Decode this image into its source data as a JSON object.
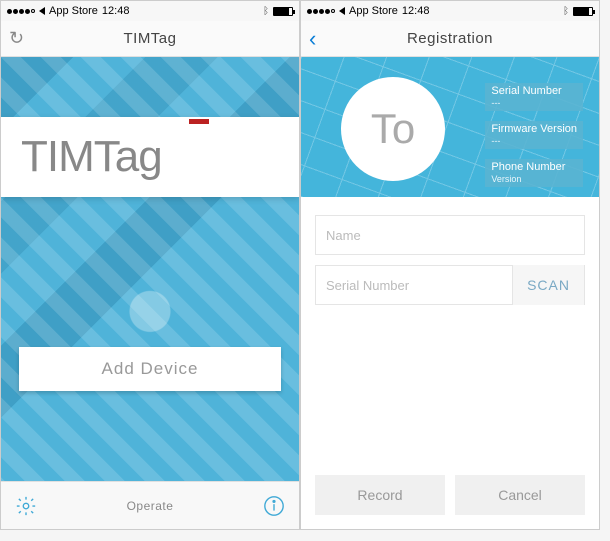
{
  "status": {
    "carrier": "App Store",
    "time": "12:48"
  },
  "screen1": {
    "nav_title": "TIMTag",
    "brand": "TIMTag",
    "add_device": "Add Device",
    "bottom_label": "Operate"
  },
  "screen2": {
    "nav_title": "Registration",
    "avatar_text": "To",
    "info": {
      "serial_label": "Serial Number",
      "serial_value": "---",
      "firmware_label": "Firmware Version",
      "firmware_value": "---",
      "phone_label": "Phone Number",
      "version_label": "Version"
    },
    "name_placeholder": "Name",
    "serial_placeholder": "Serial Number",
    "scan": "SCAN",
    "record": "Record",
    "cancel": "Cancel"
  }
}
